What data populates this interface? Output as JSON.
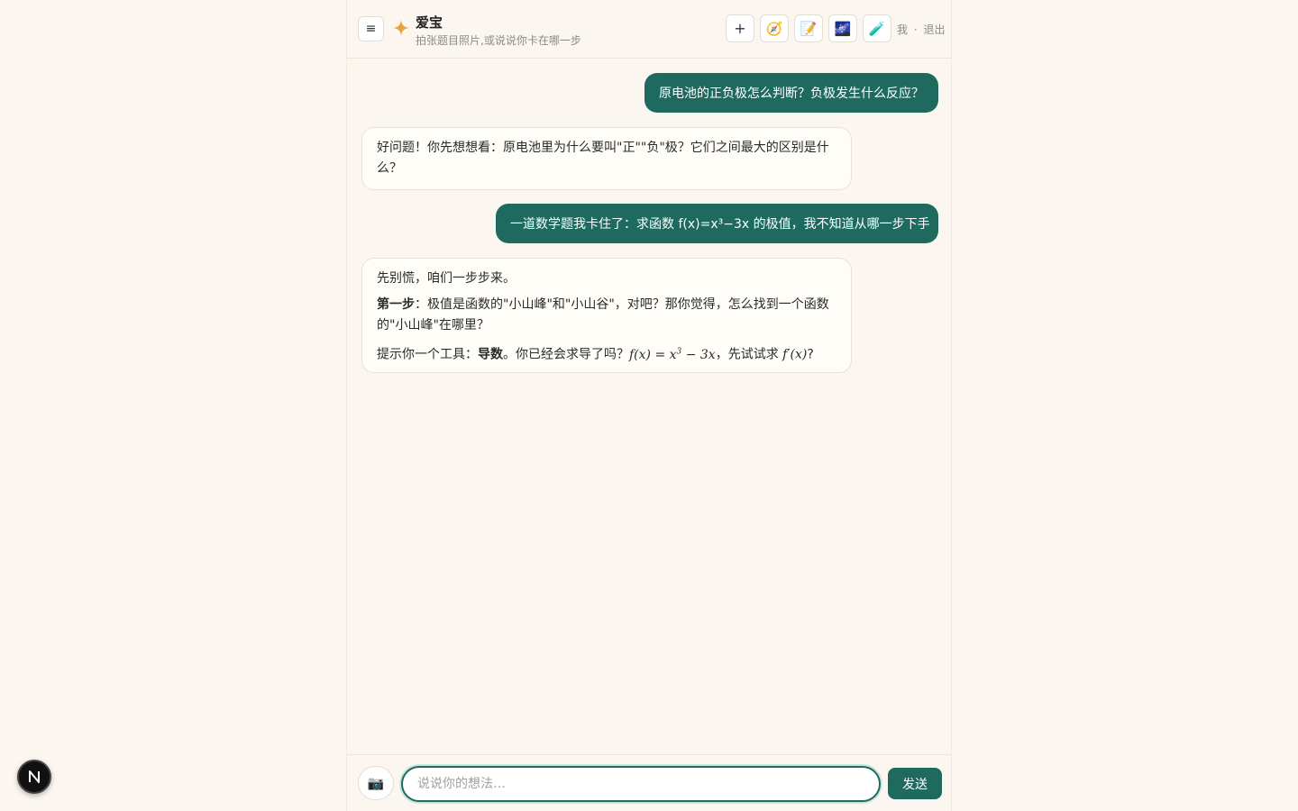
{
  "header": {
    "menu_icon": "≡",
    "title": "爱宝",
    "subtitle": "拍张题目照片,或说说你卡在哪一步",
    "tools": [
      {
        "name": "new-chat-icon",
        "glyph": "+"
      },
      {
        "name": "compass-icon",
        "glyph": "🧭"
      },
      {
        "name": "memo-icon",
        "glyph": "📝"
      },
      {
        "name": "stars-image-icon",
        "glyph": "🌌"
      },
      {
        "name": "test-tube-icon",
        "glyph": "🧪"
      }
    ],
    "user": "我",
    "separator": "·",
    "logout": "退出"
  },
  "messages": {
    "m1": "原电池的正负极怎么判断？负极发生什么反应？",
    "m2": "好问题！你先想想看：原电池里为什么要叫\"正\"\"负\"极？它们之间最大的区别是什么？",
    "m3": "一道数学题我卡住了：求函数 f(x)=x³−3x 的极值，我不知道从哪一步下手",
    "m4": {
      "line1": "先别慌，咱们一步步来。",
      "line2_bold": "第一步",
      "line2_rest": "：极值是函数的\"小山峰\"和\"小山谷\"，对吧？那你觉得，怎么找到一个函数的\"小山峰\"在哪里？",
      "line3_pre": "提示你一个工具：",
      "line3_bold": "导数",
      "line3_mid": "。你已经会求导了吗？",
      "line3_math1": "f(x) = x",
      "line3_math1_sup": "3",
      "line3_math1_tail": " − 3x",
      "line3_mid2": "，先试试求 ",
      "line3_math2": "f′(x)",
      "line3_end": "?"
    }
  },
  "composer": {
    "camera_glyph": "📷",
    "placeholder": "说说你的想法…",
    "value": "",
    "send_label": "发送"
  },
  "badge": {
    "letter": "N"
  },
  "colors": {
    "accent": "#1e6a5f",
    "background": "#fbf7f0",
    "spark": "#e8a33c"
  }
}
